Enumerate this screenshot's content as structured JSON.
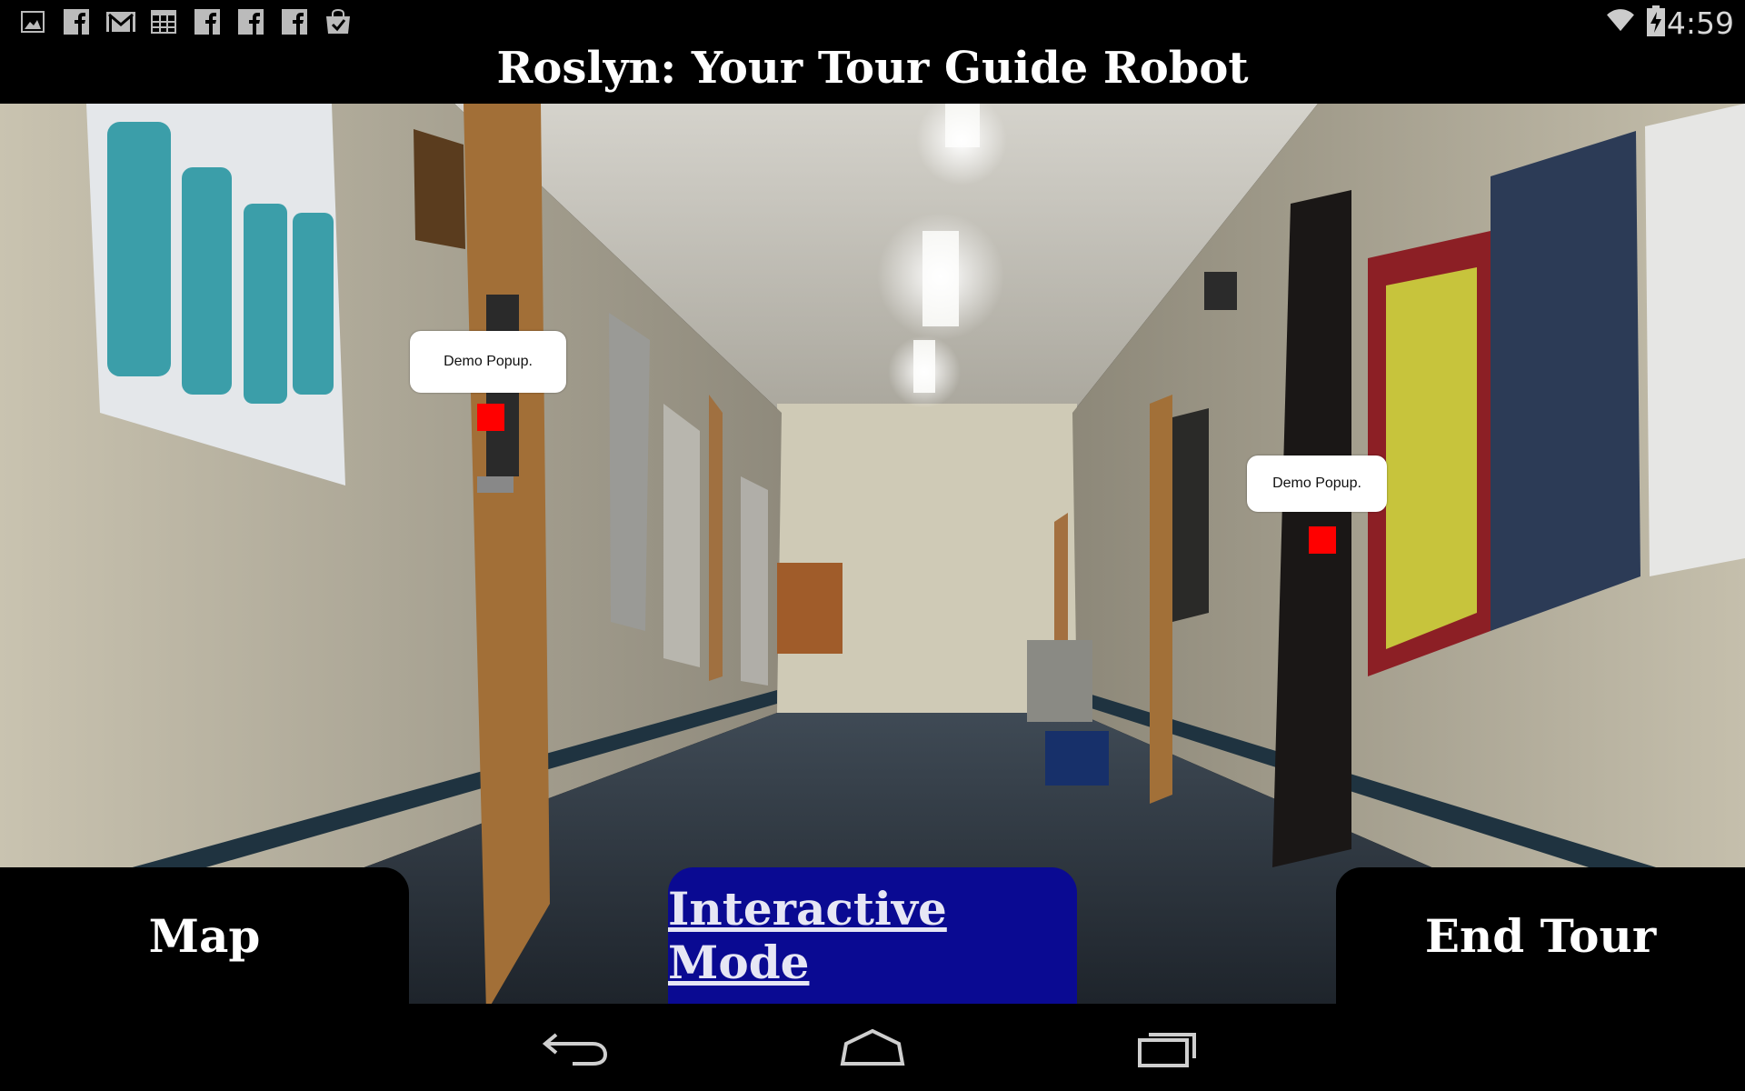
{
  "status_bar": {
    "notification_icons": [
      "image-icon",
      "facebook-icon",
      "gmail-icon",
      "calendar-icon",
      "facebook-icon",
      "facebook-icon",
      "facebook-icon",
      "shopping-bag-check-icon"
    ],
    "system_icons": [
      "wifi-icon",
      "battery-charging-icon"
    ],
    "time": "4:59"
  },
  "app": {
    "title": "Roslyn: Your Tour Guide Robot"
  },
  "scene": {
    "description_icon": "hallway-camera-view",
    "popups": [
      {
        "text": "Demo Popup.",
        "marker_color": "#ff0000"
      },
      {
        "text": "Demo Popup.",
        "marker_color": "#ff0000"
      }
    ]
  },
  "buttons": {
    "map": "Map",
    "interactive_mode": "Interactive Mode",
    "end_tour": "End Tour",
    "active_color": "#0a0a92"
  },
  "nav_bar": {
    "buttons": [
      "back-icon",
      "home-icon",
      "recent-apps-icon"
    ]
  }
}
